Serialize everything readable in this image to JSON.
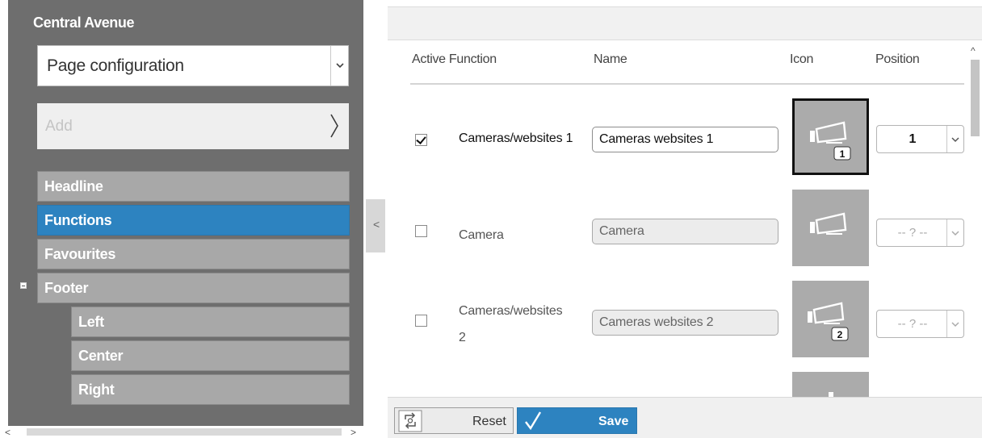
{
  "sidebar": {
    "title": "Central Avenue",
    "page_select": {
      "value": "Page configuration"
    },
    "add": {
      "label": "Add"
    },
    "tree": [
      {
        "label": "Headline",
        "active": false,
        "level": 0
      },
      {
        "label": "Functions",
        "active": true,
        "level": 0
      },
      {
        "label": "Favourites",
        "active": false,
        "level": 0
      },
      {
        "label": "Footer",
        "active": false,
        "level": 0,
        "expanded": true
      },
      {
        "label": "Left",
        "active": false,
        "level": 1
      },
      {
        "label": "Center",
        "active": false,
        "level": 1
      },
      {
        "label": "Right",
        "active": false,
        "level": 1
      }
    ]
  },
  "table": {
    "columns": {
      "active_function": "Active Function",
      "name": "Name",
      "icon": "Icon",
      "position": "Position"
    },
    "rows": [
      {
        "active": true,
        "function": "Cameras/websites 1",
        "name": "Cameras websites 1",
        "icon": "camera-icon",
        "icon_badge": "1",
        "position": "1"
      },
      {
        "active": false,
        "function": "Camera",
        "name": "Camera",
        "icon": "camera-icon",
        "position": "-- ? --"
      },
      {
        "active": false,
        "function_line1": "Cameras/websites",
        "function_line2": "2",
        "name": "Cameras websites 2",
        "icon": "camera-icon",
        "icon_badge": "2",
        "position": "-- ? --"
      }
    ]
  },
  "footer": {
    "reset_label": "Reset",
    "save_label": "Save"
  },
  "colors": {
    "accent": "#2d83c0",
    "sidebar_bg": "#6e6e6e",
    "tree_item_bg": "#a8a8a8",
    "icon_tile_bg": "#ababab"
  }
}
